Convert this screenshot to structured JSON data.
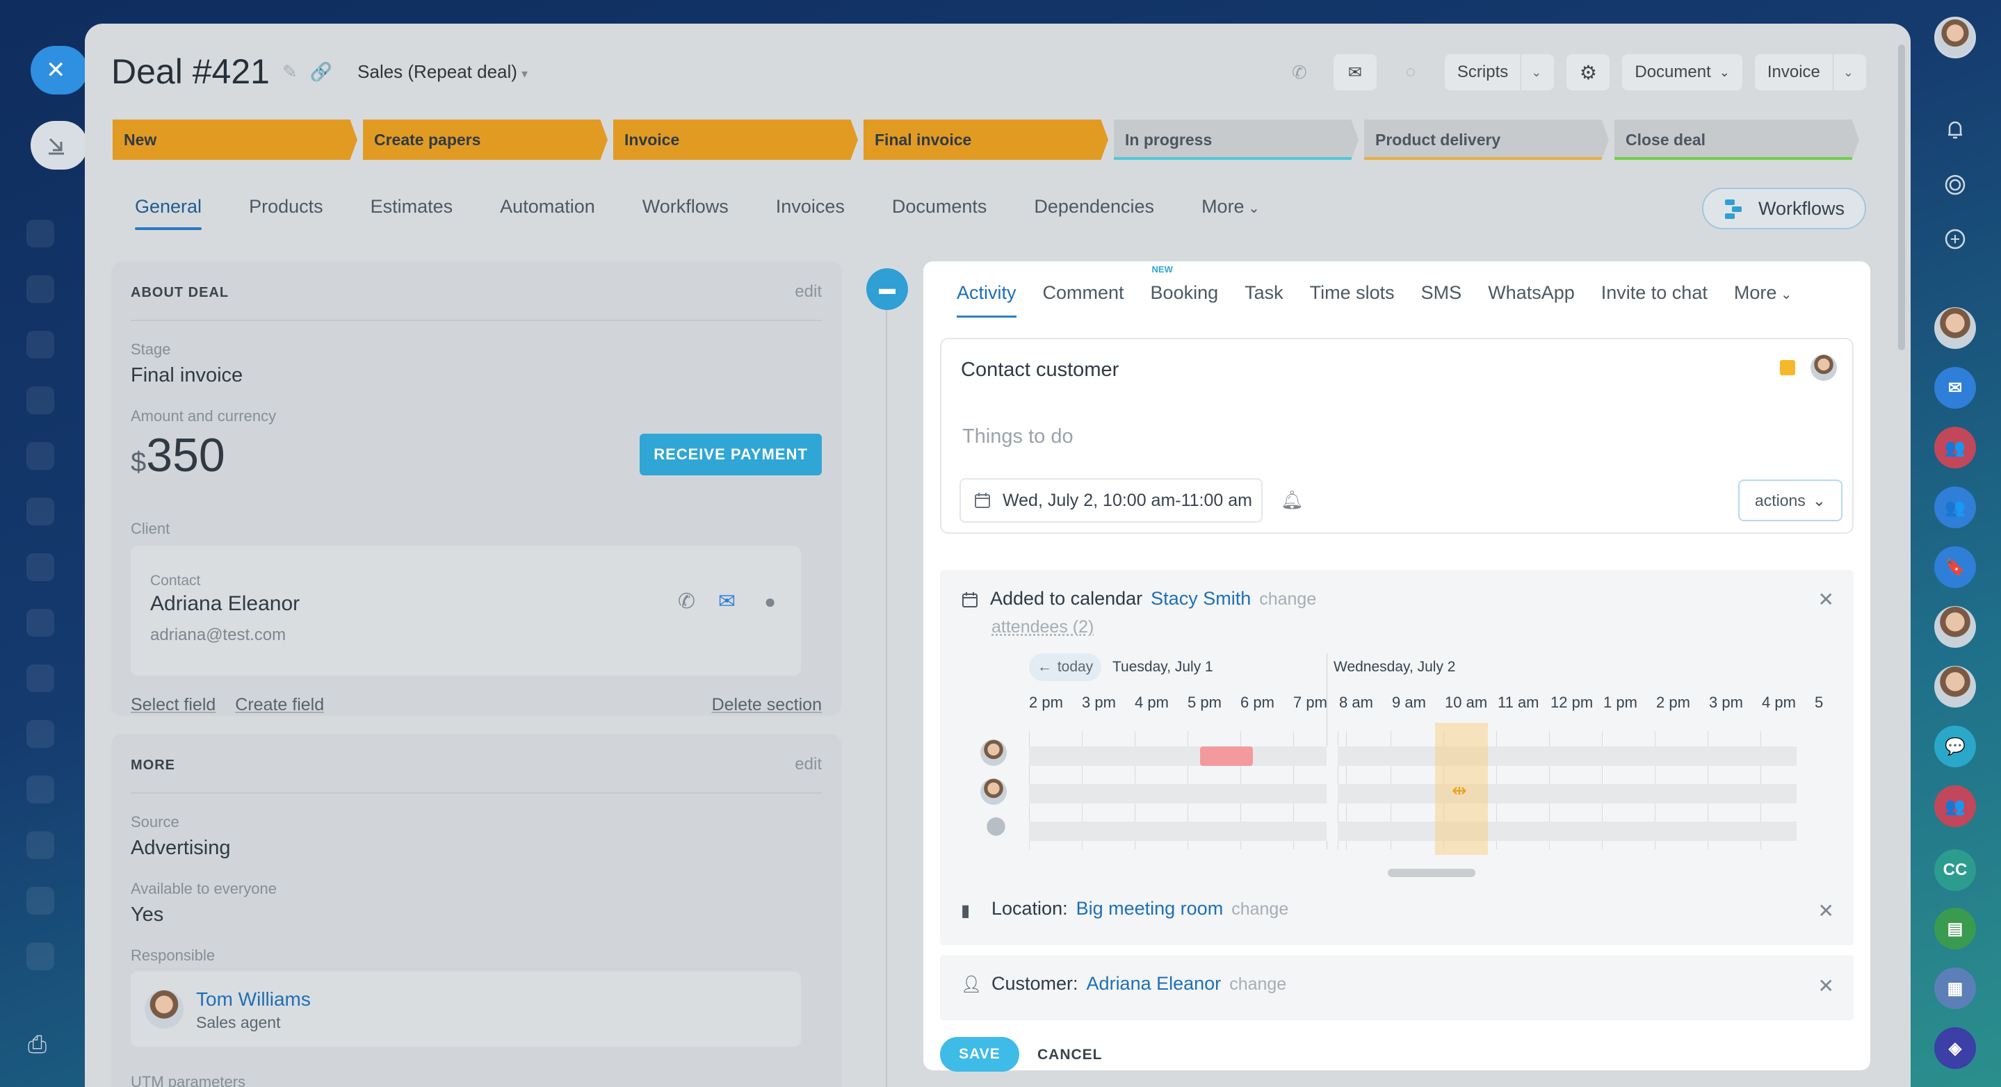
{
  "deal": {
    "title": "Deal #421",
    "category": "Sales (Repeat deal)"
  },
  "header": {
    "scripts": "Scripts",
    "document": "Document",
    "invoice": "Invoice"
  },
  "stages": [
    {
      "label": "New",
      "state": "done"
    },
    {
      "label": "Create papers",
      "state": "done"
    },
    {
      "label": "Invoice",
      "state": "done"
    },
    {
      "label": "Final invoice",
      "state": "done"
    },
    {
      "label": "In progress",
      "state": "todo",
      "color": "#52c7d6"
    },
    {
      "label": "Product delivery",
      "state": "todo",
      "color": "#e8b040"
    },
    {
      "label": "Close deal",
      "state": "todo",
      "color": "#6fcf4a"
    }
  ],
  "tabs": [
    "General",
    "Products",
    "Estimates",
    "Automation",
    "Workflows",
    "Invoices",
    "Documents",
    "Dependencies",
    "More"
  ],
  "workflows_button": "Workflows",
  "about": {
    "heading": "ABOUT DEAL",
    "edit": "edit",
    "stage_label": "Stage",
    "stage_value": "Final invoice",
    "amount_label": "Amount and currency",
    "currency": "$",
    "amount": "350",
    "receive_payment": "RECEIVE PAYMENT",
    "client_label": "Client",
    "contact_label": "Contact",
    "contact_name": "Adriana Eleanor",
    "contact_email": "adriana@test.com",
    "select_field": "Select field",
    "create_field": "Create field",
    "delete_section": "Delete section"
  },
  "more": {
    "heading": "MORE",
    "edit": "edit",
    "source_label": "Source",
    "source_value": "Advertising",
    "available_label": "Available to everyone",
    "available_value": "Yes",
    "responsible_label": "Responsible",
    "responsible_name": "Tom Williams",
    "responsible_role": "Sales agent",
    "utm_label": "UTM parameters"
  },
  "activity": {
    "tabs": [
      "Activity",
      "Comment",
      "Booking",
      "Task",
      "Time slots",
      "SMS",
      "WhatsApp",
      "Invite to chat",
      "More"
    ],
    "booking_badge": "NEW",
    "title": "Contact customer",
    "todo_placeholder": "Things to do",
    "datetime": "Wed, July 2, 10:00 am-11:00 am",
    "actions": "actions",
    "calendar_text": "Added to calendar",
    "calendar_user": "Stacy Smith",
    "change": "change",
    "attendees": "attendees (2)",
    "today": "today",
    "day1": "Tuesday, July 1",
    "day2": "Wednesday, July 2",
    "hours1": [
      "2 pm",
      "3 pm",
      "4 pm",
      "5 pm",
      "6 pm",
      "7 pm"
    ],
    "hours2": [
      "8 am",
      "9 am",
      "10 am",
      "11 am",
      "12 pm",
      "1 pm",
      "2 pm",
      "3 pm",
      "4 pm",
      "5"
    ],
    "location_label": "Location:",
    "location_value": "Big meeting room",
    "customer_label": "Customer:",
    "customer_value": "Adriana Eleanor",
    "save": "SAVE",
    "cancel": "CANCEL"
  },
  "rail": {
    "cc_initials": "CC"
  },
  "colors": {
    "stage_done": "#e29b22",
    "accent": "#2fa6d6",
    "link": "#1f6fb5"
  }
}
